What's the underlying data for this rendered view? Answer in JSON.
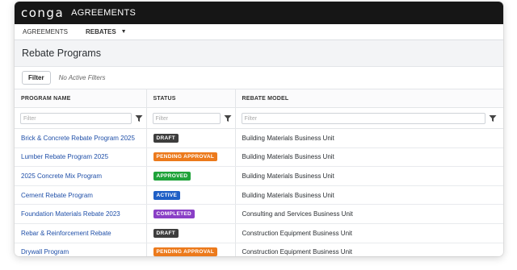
{
  "app": {
    "logo": "conga",
    "title": "AGREEMENTS"
  },
  "nav": [
    {
      "label": "AGREEMENTS",
      "active": false
    },
    {
      "label": "REBATES",
      "active": true
    }
  ],
  "page": {
    "title": "Rebate Programs"
  },
  "filterbar": {
    "button": "Filter",
    "status": "No Active Filters"
  },
  "table": {
    "columns": [
      "PROGRAM NAME",
      "STATUS",
      "REBATE MODEL"
    ],
    "filter_placeholder": "Filter",
    "rows": [
      {
        "name": "Brick & Concrete Rebate Program 2025",
        "status": "DRAFT",
        "status_color": "#3d3d3d",
        "model": "Building Materials Business Unit"
      },
      {
        "name": "Lumber Rebate Program 2025",
        "status": "PENDING APPROVAL",
        "status_color": "#ec7a1c",
        "model": "Building Materials Business Unit"
      },
      {
        "name": "2025 Concrete Mix Program",
        "status": "APPROVED",
        "status_color": "#1fa33a",
        "model": "Building Materials Business Unit"
      },
      {
        "name": "Cement Rebate Program",
        "status": "ACTIVE",
        "status_color": "#1f5fc6",
        "model": "Building Materials Business Unit"
      },
      {
        "name": "Foundation Materials Rebate 2023",
        "status": "COMPLETED",
        "status_color": "#8a3fc6",
        "model": "Consulting and Services Business Unit"
      },
      {
        "name": "Rebar & Reinforcement Rebate",
        "status": "DRAFT",
        "status_color": "#3d3d3d",
        "model": "Construction Equipment Business Unit"
      },
      {
        "name": "Drywall Program",
        "status": "PENDING APPROVAL",
        "status_color": "#ec7a1c",
        "model": "Construction Equipment Business Unit"
      }
    ]
  }
}
